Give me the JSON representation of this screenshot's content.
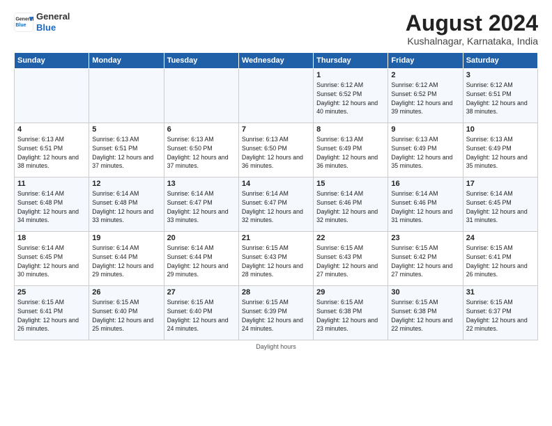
{
  "logo": {
    "line1": "General",
    "line2": "Blue"
  },
  "title": "August 2024",
  "subtitle": "Kushalnagar, Karnataka, India",
  "footer": "Daylight hours",
  "headers": [
    "Sunday",
    "Monday",
    "Tuesday",
    "Wednesday",
    "Thursday",
    "Friday",
    "Saturday"
  ],
  "weeks": [
    [
      {
        "day": "",
        "info": ""
      },
      {
        "day": "",
        "info": ""
      },
      {
        "day": "",
        "info": ""
      },
      {
        "day": "",
        "info": ""
      },
      {
        "day": "1",
        "info": "Sunrise: 6:12 AM\nSunset: 6:52 PM\nDaylight: 12 hours\nand 40 minutes."
      },
      {
        "day": "2",
        "info": "Sunrise: 6:12 AM\nSunset: 6:52 PM\nDaylight: 12 hours\nand 39 minutes."
      },
      {
        "day": "3",
        "info": "Sunrise: 6:12 AM\nSunset: 6:51 PM\nDaylight: 12 hours\nand 38 minutes."
      }
    ],
    [
      {
        "day": "4",
        "info": "Sunrise: 6:13 AM\nSunset: 6:51 PM\nDaylight: 12 hours\nand 38 minutes."
      },
      {
        "day": "5",
        "info": "Sunrise: 6:13 AM\nSunset: 6:51 PM\nDaylight: 12 hours\nand 37 minutes."
      },
      {
        "day": "6",
        "info": "Sunrise: 6:13 AM\nSunset: 6:50 PM\nDaylight: 12 hours\nand 37 minutes."
      },
      {
        "day": "7",
        "info": "Sunrise: 6:13 AM\nSunset: 6:50 PM\nDaylight: 12 hours\nand 36 minutes."
      },
      {
        "day": "8",
        "info": "Sunrise: 6:13 AM\nSunset: 6:49 PM\nDaylight: 12 hours\nand 36 minutes."
      },
      {
        "day": "9",
        "info": "Sunrise: 6:13 AM\nSunset: 6:49 PM\nDaylight: 12 hours\nand 35 minutes."
      },
      {
        "day": "10",
        "info": "Sunrise: 6:13 AM\nSunset: 6:49 PM\nDaylight: 12 hours\nand 35 minutes."
      }
    ],
    [
      {
        "day": "11",
        "info": "Sunrise: 6:14 AM\nSunset: 6:48 PM\nDaylight: 12 hours\nand 34 minutes."
      },
      {
        "day": "12",
        "info": "Sunrise: 6:14 AM\nSunset: 6:48 PM\nDaylight: 12 hours\nand 33 minutes."
      },
      {
        "day": "13",
        "info": "Sunrise: 6:14 AM\nSunset: 6:47 PM\nDaylight: 12 hours\nand 33 minutes."
      },
      {
        "day": "14",
        "info": "Sunrise: 6:14 AM\nSunset: 6:47 PM\nDaylight: 12 hours\nand 32 minutes."
      },
      {
        "day": "15",
        "info": "Sunrise: 6:14 AM\nSunset: 6:46 PM\nDaylight: 12 hours\nand 32 minutes."
      },
      {
        "day": "16",
        "info": "Sunrise: 6:14 AM\nSunset: 6:46 PM\nDaylight: 12 hours\nand 31 minutes."
      },
      {
        "day": "17",
        "info": "Sunrise: 6:14 AM\nSunset: 6:45 PM\nDaylight: 12 hours\nand 31 minutes."
      }
    ],
    [
      {
        "day": "18",
        "info": "Sunrise: 6:14 AM\nSunset: 6:45 PM\nDaylight: 12 hours\nand 30 minutes."
      },
      {
        "day": "19",
        "info": "Sunrise: 6:14 AM\nSunset: 6:44 PM\nDaylight: 12 hours\nand 29 minutes."
      },
      {
        "day": "20",
        "info": "Sunrise: 6:14 AM\nSunset: 6:44 PM\nDaylight: 12 hours\nand 29 minutes."
      },
      {
        "day": "21",
        "info": "Sunrise: 6:15 AM\nSunset: 6:43 PM\nDaylight: 12 hours\nand 28 minutes."
      },
      {
        "day": "22",
        "info": "Sunrise: 6:15 AM\nSunset: 6:43 PM\nDaylight: 12 hours\nand 27 minutes."
      },
      {
        "day": "23",
        "info": "Sunrise: 6:15 AM\nSunset: 6:42 PM\nDaylight: 12 hours\nand 27 minutes."
      },
      {
        "day": "24",
        "info": "Sunrise: 6:15 AM\nSunset: 6:41 PM\nDaylight: 12 hours\nand 26 minutes."
      }
    ],
    [
      {
        "day": "25",
        "info": "Sunrise: 6:15 AM\nSunset: 6:41 PM\nDaylight: 12 hours\nand 26 minutes."
      },
      {
        "day": "26",
        "info": "Sunrise: 6:15 AM\nSunset: 6:40 PM\nDaylight: 12 hours\nand 25 minutes."
      },
      {
        "day": "27",
        "info": "Sunrise: 6:15 AM\nSunset: 6:40 PM\nDaylight: 12 hours\nand 24 minutes."
      },
      {
        "day": "28",
        "info": "Sunrise: 6:15 AM\nSunset: 6:39 PM\nDaylight: 12 hours\nand 24 minutes."
      },
      {
        "day": "29",
        "info": "Sunrise: 6:15 AM\nSunset: 6:38 PM\nDaylight: 12 hours\nand 23 minutes."
      },
      {
        "day": "30",
        "info": "Sunrise: 6:15 AM\nSunset: 6:38 PM\nDaylight: 12 hours\nand 22 minutes."
      },
      {
        "day": "31",
        "info": "Sunrise: 6:15 AM\nSunset: 6:37 PM\nDaylight: 12 hours\nand 22 minutes."
      }
    ]
  ]
}
